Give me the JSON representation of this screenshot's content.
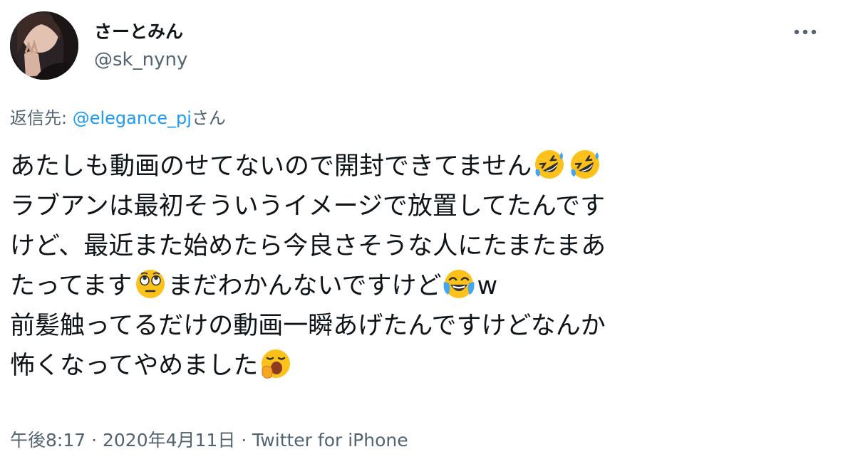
{
  "user": {
    "display_name": "さーとみん",
    "handle": "@sk_nyny"
  },
  "reply": {
    "prefix": "返信先: ",
    "mention": "@elegance_pj",
    "suffix": "さん"
  },
  "tweet": {
    "segments": {
      "l1": "あたしも動画のせてないので開封できてません",
      "l2": "ラブアンは最初そういうイメージで放置してたんです",
      "l3": "けど、最近また始めたら今良さそうな人にたまたまあ",
      "l4a": "たってます",
      "l4b": "まだわかんないですけど",
      "l4c": "w",
      "l5": "前髪触ってるだけの動画一瞬あげたんですけどなんか",
      "l6": "怖くなってやめました"
    },
    "emojis": {
      "l1_1": "rolling-on-floor-laughing",
      "l1_2": "rolling-on-floor-laughing",
      "l4_1": "face-with-rolling-eyes",
      "l4_2": "face-with-tears-of-joy",
      "l6_1": "yawning-face"
    }
  },
  "meta": {
    "time": "午後8:17",
    "sep1": " · ",
    "date": "2020年4月11日",
    "sep2": " · ",
    "source": "Twitter for iPhone"
  },
  "colors": {
    "text": "#0f1419",
    "secondary": "#536471",
    "link": "#1d9bf0",
    "emoji_face": "#fcc21b"
  },
  "icons": {
    "more": "more-horizontal-icon"
  }
}
